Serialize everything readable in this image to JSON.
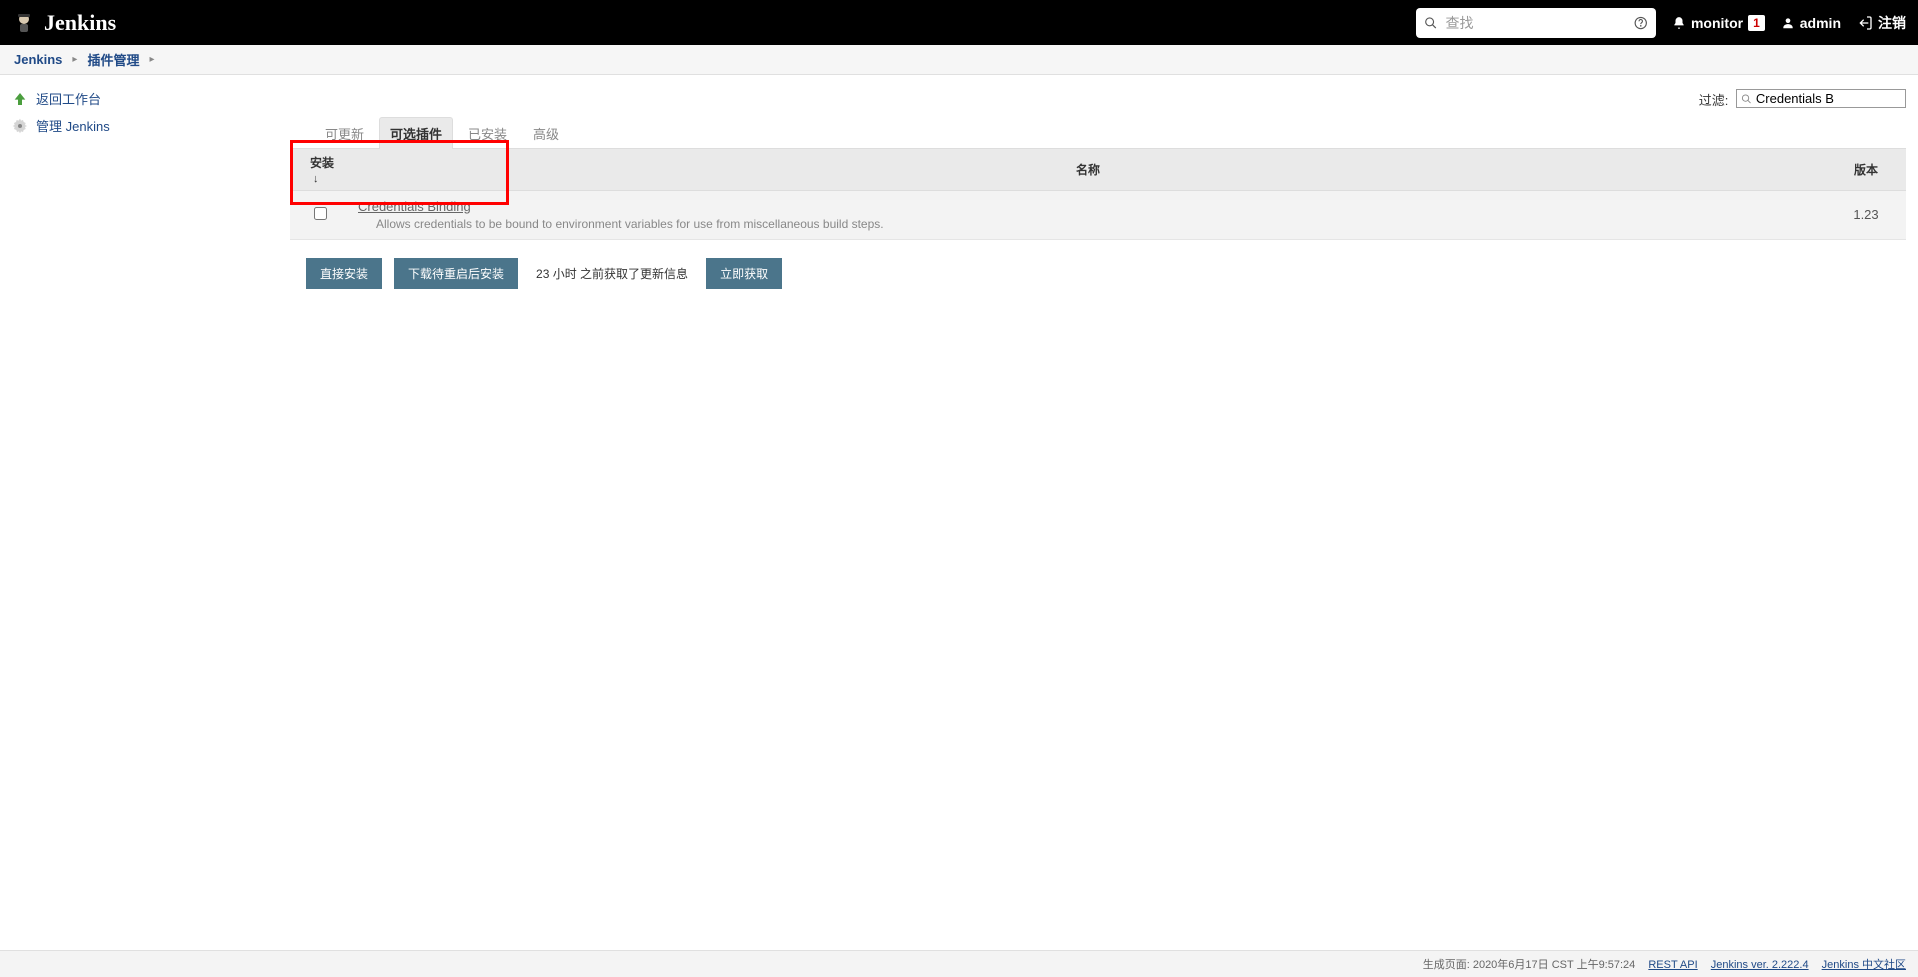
{
  "header": {
    "brand": "Jenkins",
    "search_placeholder": "查找",
    "monitor_label": "monitor",
    "monitor_count": "1",
    "user": "admin",
    "logout": "注销"
  },
  "breadcrumb": {
    "items": [
      "Jenkins",
      "插件管理"
    ]
  },
  "sidebar": {
    "back_label": "返回工作台",
    "manage_label": "管理 Jenkins"
  },
  "filter": {
    "label": "过滤:",
    "value": "Credentials B"
  },
  "tabs": {
    "updates": "可更新",
    "available": "可选插件",
    "installed": "已安装",
    "advanced": "高级"
  },
  "table": {
    "col_install": "安装",
    "col_name": "名称",
    "col_version": "版本",
    "rows": [
      {
        "name": "Credentials Binding",
        "desc": "Allows credentials to be bound to environment variables for use from miscellaneous build steps.",
        "version": "1.23"
      }
    ]
  },
  "buttons": {
    "install_now": "直接安装",
    "download_restart": "下载待重启后安装",
    "check_now": "立即获取",
    "update_info": "23 小时 之前获取了更新信息"
  },
  "footer": {
    "gen": "生成页面: 2020年6月17日 CST 上午9:57:24",
    "rest": "REST API",
    "version": "Jenkins ver. 2.222.4",
    "community": "Jenkins 中文社区"
  }
}
